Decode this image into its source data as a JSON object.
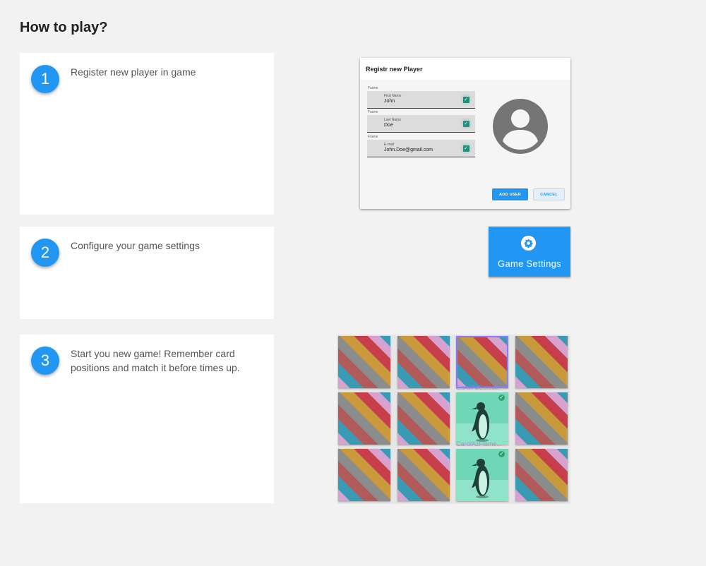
{
  "page_title": "How to play?",
  "steps": [
    {
      "number": "1",
      "text": "Register new player in game"
    },
    {
      "number": "2",
      "text": "Configure your game settings"
    },
    {
      "number": "3",
      "text": "Start you new game! Remember card positions and match it before times up."
    }
  ],
  "register_dialog": {
    "title": "Registr new Player",
    "frame_label": "Frame",
    "fields": [
      {
        "label": "First Name",
        "value": "John"
      },
      {
        "label": "Last Name",
        "value": "Doe"
      },
      {
        "label": "E-mail",
        "value": "John.Doe@gmail.com"
      }
    ],
    "add_button": "ADD USER",
    "cancel_button": "CANCEL",
    "avatar_icon": "account-circle-icon"
  },
  "settings_button": {
    "label": "Game Settings",
    "icon": "gear-icon"
  },
  "card_board": {
    "rows": 3,
    "cols": 4,
    "cards": [
      {
        "state": "back"
      },
      {
        "state": "back"
      },
      {
        "state": "back-selected",
        "caption": "Card/AzSelect..."
      },
      {
        "state": "back"
      },
      {
        "state": "back"
      },
      {
        "state": "back"
      },
      {
        "state": "face-matched",
        "image": "penguin",
        "caption": "Card/AzFlame..."
      },
      {
        "state": "back"
      },
      {
        "state": "back"
      },
      {
        "state": "back"
      },
      {
        "state": "face-matched",
        "image": "penguin"
      },
      {
        "state": "back"
      }
    ],
    "colors": {
      "card_back_stripes": [
        "#d6a2cf",
        "#3a9ab4",
        "#b25a5a",
        "#8c8c8c",
        "#c89a3c",
        "#c73f4a"
      ],
      "card_face": "#6fd6b6",
      "selection": "#8c7ef2"
    }
  },
  "colors": {
    "accent": "#2196f3",
    "background": "#f2f2f2"
  }
}
